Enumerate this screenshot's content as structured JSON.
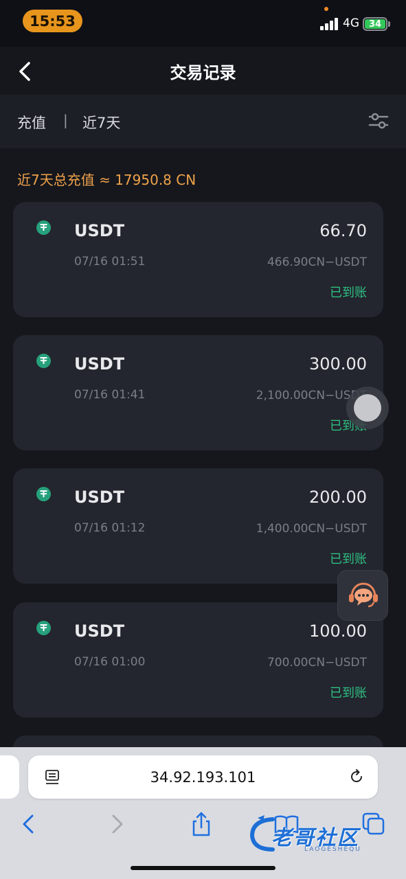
{
  "status_bar": {
    "time": "15:53",
    "network": "4G",
    "battery": "34"
  },
  "nav": {
    "title": "交易记录"
  },
  "filter": {
    "type": "充值",
    "separator": "|",
    "range": "近7天"
  },
  "summary": {
    "text": "近7天总充值 ≈ 17950.8 CN"
  },
  "records": [
    {
      "coin": "USDT",
      "amount": "66.70",
      "date": "07/16 01:51",
      "detail": "466.90CN−USDT",
      "status": "已到账"
    },
    {
      "coin": "USDT",
      "amount": "300.00",
      "date": "07/16 01:41",
      "detail": "2,100.00CN−USDT",
      "status": "已到账"
    },
    {
      "coin": "USDT",
      "amount": "200.00",
      "date": "07/16 01:12",
      "detail": "1,400.00CN−USDT",
      "status": "已到账"
    },
    {
      "coin": "USDT",
      "amount": "100.00",
      "date": "07/16 01:00",
      "detail": "700.00CN−USDT",
      "status": "已到账"
    }
  ],
  "browser": {
    "url": "34.92.193.101"
  },
  "watermark": {
    "text": "老哥社区",
    "sub": "LAOGESHEQU"
  },
  "colors": {
    "background": "#15171d",
    "card": "#23262e",
    "accent_orange": "#f0a24a",
    "status_green": "#2fbf83",
    "tether_green": "#26a17b"
  }
}
